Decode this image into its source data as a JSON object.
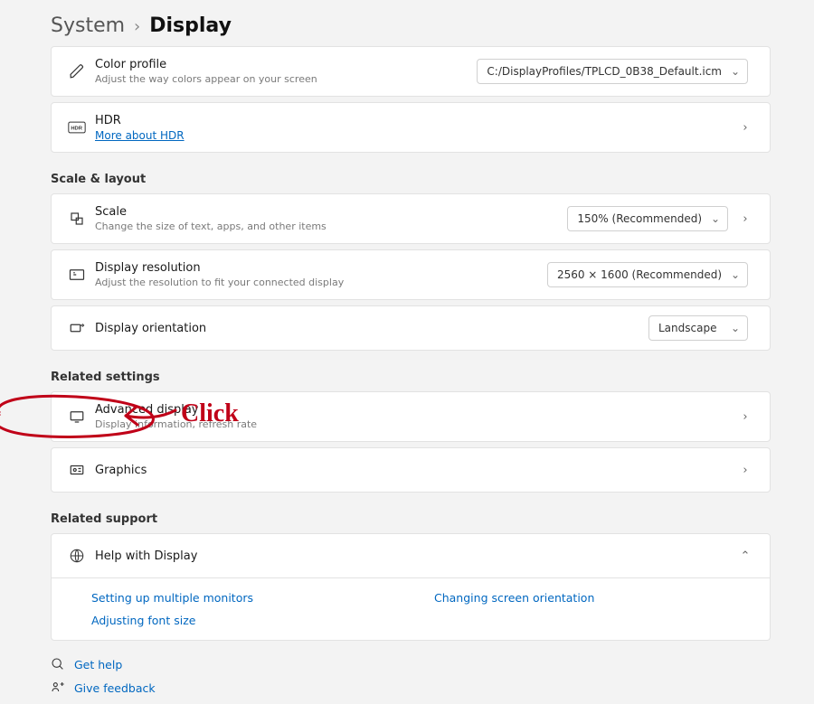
{
  "breadcrumb": {
    "parent": "System",
    "current": "Display"
  },
  "rows": {
    "color_profile": {
      "title": "Color profile",
      "sub": "Adjust the way colors appear on your screen",
      "value": "C:/DisplayProfiles/TPLCD_0B38_Default.icm"
    },
    "hdr": {
      "title": "HDR",
      "link": "More about HDR"
    }
  },
  "sections": {
    "scale_layout": {
      "label": "Scale & layout",
      "scale": {
        "title": "Scale",
        "sub": "Change the size of text, apps, and other items",
        "value": "150% (Recommended)"
      },
      "resolution": {
        "title": "Display resolution",
        "sub": "Adjust the resolution to fit your connected display",
        "value": "2560 × 1600 (Recommended)"
      },
      "orientation": {
        "title": "Display orientation",
        "value": "Landscape"
      }
    },
    "related_settings": {
      "label": "Related settings",
      "advanced": {
        "title": "Advanced display",
        "sub": "Display information, refresh rate"
      },
      "graphics": {
        "title": "Graphics"
      }
    },
    "related_support": {
      "label": "Related support",
      "help": {
        "title": "Help with Display"
      },
      "links": {
        "multi": "Setting up multiple monitors",
        "orient": "Changing screen orientation",
        "font": "Adjusting font size"
      }
    }
  },
  "footer": {
    "get_help": "Get help",
    "feedback": "Give feedback"
  },
  "annotation": {
    "text": "Click"
  }
}
